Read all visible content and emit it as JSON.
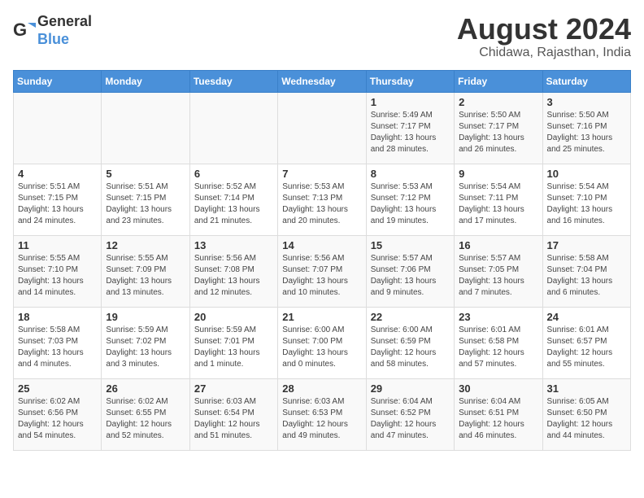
{
  "header": {
    "logo_line1": "General",
    "logo_line2": "Blue",
    "month_title": "August 2024",
    "subtitle": "Chidawa, Rajasthan, India"
  },
  "weekdays": [
    "Sunday",
    "Monday",
    "Tuesday",
    "Wednesday",
    "Thursday",
    "Friday",
    "Saturday"
  ],
  "weeks": [
    [
      {
        "day": "",
        "info": ""
      },
      {
        "day": "",
        "info": ""
      },
      {
        "day": "",
        "info": ""
      },
      {
        "day": "",
        "info": ""
      },
      {
        "day": "1",
        "info": "Sunrise: 5:49 AM\nSunset: 7:17 PM\nDaylight: 13 hours\nand 28 minutes."
      },
      {
        "day": "2",
        "info": "Sunrise: 5:50 AM\nSunset: 7:17 PM\nDaylight: 13 hours\nand 26 minutes."
      },
      {
        "day": "3",
        "info": "Sunrise: 5:50 AM\nSunset: 7:16 PM\nDaylight: 13 hours\nand 25 minutes."
      }
    ],
    [
      {
        "day": "4",
        "info": "Sunrise: 5:51 AM\nSunset: 7:15 PM\nDaylight: 13 hours\nand 24 minutes."
      },
      {
        "day": "5",
        "info": "Sunrise: 5:51 AM\nSunset: 7:15 PM\nDaylight: 13 hours\nand 23 minutes."
      },
      {
        "day": "6",
        "info": "Sunrise: 5:52 AM\nSunset: 7:14 PM\nDaylight: 13 hours\nand 21 minutes."
      },
      {
        "day": "7",
        "info": "Sunrise: 5:53 AM\nSunset: 7:13 PM\nDaylight: 13 hours\nand 20 minutes."
      },
      {
        "day": "8",
        "info": "Sunrise: 5:53 AM\nSunset: 7:12 PM\nDaylight: 13 hours\nand 19 minutes."
      },
      {
        "day": "9",
        "info": "Sunrise: 5:54 AM\nSunset: 7:11 PM\nDaylight: 13 hours\nand 17 minutes."
      },
      {
        "day": "10",
        "info": "Sunrise: 5:54 AM\nSunset: 7:10 PM\nDaylight: 13 hours\nand 16 minutes."
      }
    ],
    [
      {
        "day": "11",
        "info": "Sunrise: 5:55 AM\nSunset: 7:10 PM\nDaylight: 13 hours\nand 14 minutes."
      },
      {
        "day": "12",
        "info": "Sunrise: 5:55 AM\nSunset: 7:09 PM\nDaylight: 13 hours\nand 13 minutes."
      },
      {
        "day": "13",
        "info": "Sunrise: 5:56 AM\nSunset: 7:08 PM\nDaylight: 13 hours\nand 12 minutes."
      },
      {
        "day": "14",
        "info": "Sunrise: 5:56 AM\nSunset: 7:07 PM\nDaylight: 13 hours\nand 10 minutes."
      },
      {
        "day": "15",
        "info": "Sunrise: 5:57 AM\nSunset: 7:06 PM\nDaylight: 13 hours\nand 9 minutes."
      },
      {
        "day": "16",
        "info": "Sunrise: 5:57 AM\nSunset: 7:05 PM\nDaylight: 13 hours\nand 7 minutes."
      },
      {
        "day": "17",
        "info": "Sunrise: 5:58 AM\nSunset: 7:04 PM\nDaylight: 13 hours\nand 6 minutes."
      }
    ],
    [
      {
        "day": "18",
        "info": "Sunrise: 5:58 AM\nSunset: 7:03 PM\nDaylight: 13 hours\nand 4 minutes."
      },
      {
        "day": "19",
        "info": "Sunrise: 5:59 AM\nSunset: 7:02 PM\nDaylight: 13 hours\nand 3 minutes."
      },
      {
        "day": "20",
        "info": "Sunrise: 5:59 AM\nSunset: 7:01 PM\nDaylight: 13 hours\nand 1 minute."
      },
      {
        "day": "21",
        "info": "Sunrise: 6:00 AM\nSunset: 7:00 PM\nDaylight: 13 hours\nand 0 minutes."
      },
      {
        "day": "22",
        "info": "Sunrise: 6:00 AM\nSunset: 6:59 PM\nDaylight: 12 hours\nand 58 minutes."
      },
      {
        "day": "23",
        "info": "Sunrise: 6:01 AM\nSunset: 6:58 PM\nDaylight: 12 hours\nand 57 minutes."
      },
      {
        "day": "24",
        "info": "Sunrise: 6:01 AM\nSunset: 6:57 PM\nDaylight: 12 hours\nand 55 minutes."
      }
    ],
    [
      {
        "day": "25",
        "info": "Sunrise: 6:02 AM\nSunset: 6:56 PM\nDaylight: 12 hours\nand 54 minutes."
      },
      {
        "day": "26",
        "info": "Sunrise: 6:02 AM\nSunset: 6:55 PM\nDaylight: 12 hours\nand 52 minutes."
      },
      {
        "day": "27",
        "info": "Sunrise: 6:03 AM\nSunset: 6:54 PM\nDaylight: 12 hours\nand 51 minutes."
      },
      {
        "day": "28",
        "info": "Sunrise: 6:03 AM\nSunset: 6:53 PM\nDaylight: 12 hours\nand 49 minutes."
      },
      {
        "day": "29",
        "info": "Sunrise: 6:04 AM\nSunset: 6:52 PM\nDaylight: 12 hours\nand 47 minutes."
      },
      {
        "day": "30",
        "info": "Sunrise: 6:04 AM\nSunset: 6:51 PM\nDaylight: 12 hours\nand 46 minutes."
      },
      {
        "day": "31",
        "info": "Sunrise: 6:05 AM\nSunset: 6:50 PM\nDaylight: 12 hours\nand 44 minutes."
      }
    ]
  ]
}
